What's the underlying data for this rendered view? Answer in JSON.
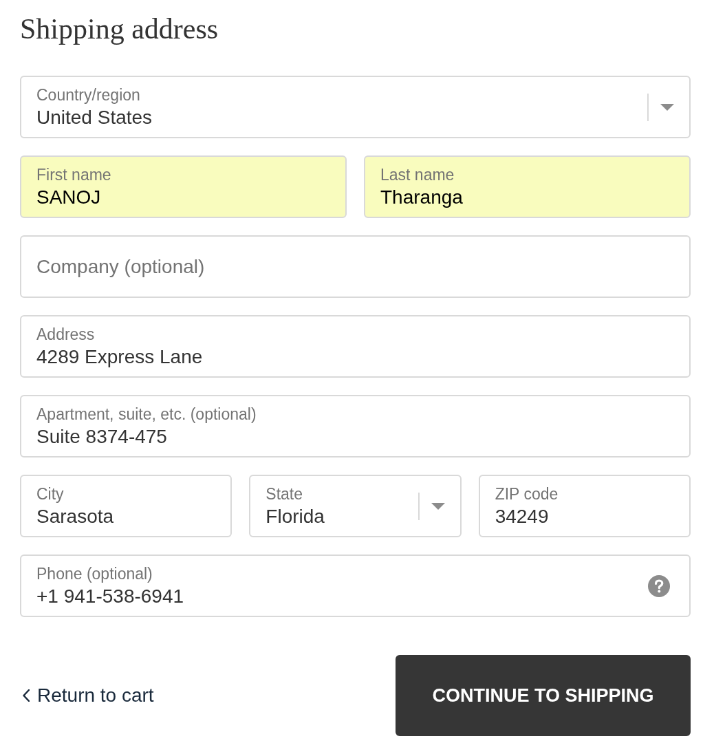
{
  "heading": "Shipping address",
  "rows": [
    [
      {
        "kind": "select",
        "label": "Country/region",
        "value": "United States",
        "autofilled": false
      }
    ],
    [
      {
        "kind": "text",
        "label": "First name",
        "value": "SANOJ",
        "autofilled": true
      },
      {
        "kind": "text",
        "label": "Last name",
        "value": "Tharanga",
        "autofilled": true
      }
    ],
    [
      {
        "kind": "text",
        "placeholder": "Company (optional)",
        "autofilled": false
      }
    ],
    [
      {
        "kind": "text",
        "label": "Address",
        "value": "4289 Express Lane",
        "autofilled": false
      }
    ],
    [
      {
        "kind": "text",
        "label": "Apartment, suite, etc. (optional)",
        "value": "Suite 8374-475",
        "autofilled": false
      }
    ],
    [
      {
        "kind": "text",
        "label": "City",
        "value": "Sarasota",
        "autofilled": false
      },
      {
        "kind": "select",
        "label": "State",
        "value": "Florida",
        "autofilled": false
      },
      {
        "kind": "text",
        "label": "ZIP code",
        "value": "34249",
        "autofilled": false
      }
    ],
    [
      {
        "kind": "text",
        "label": "Phone (optional)",
        "value": "+1 941-538-6941",
        "autofilled": false,
        "help": true
      }
    ]
  ],
  "footer": {
    "back_link": "Return to cart",
    "submit_button": "CONTINUE TO SHIPPING"
  }
}
